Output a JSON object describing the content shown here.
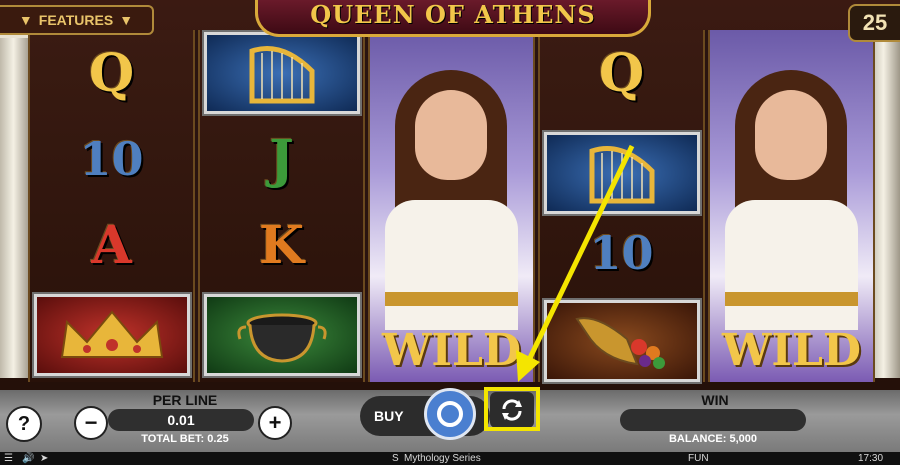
{
  "header": {
    "title": "QUEEN OF ATHENS",
    "features_label": "FEATURES",
    "lines_count": "25"
  },
  "reels": [
    {
      "symbols": [
        "Q",
        "10",
        "A",
        "crown"
      ]
    },
    {
      "symbols": [
        "harp",
        "J",
        "K",
        "cauldron"
      ]
    },
    {
      "symbols": [
        "wild"
      ]
    },
    {
      "symbols": [
        "Q",
        "harp",
        "10",
        "cornucopia"
      ]
    },
    {
      "symbols": [
        "wild"
      ]
    }
  ],
  "wild_label": "WILD",
  "controls": {
    "help_label": "?",
    "minus_label": "−",
    "plus_label": "+",
    "per_line_label": "PER LINE",
    "per_line_value": "0.01",
    "total_bet_label": "TOTAL BET: 0.25",
    "buy_label": "BUY",
    "win_label": "WIN",
    "win_value": "",
    "balance_label": "BALANCE: 5,000"
  },
  "status": {
    "series": "Mythology Series",
    "mode": "FUN",
    "time": "17:30"
  },
  "colors": {
    "gold": "#f2c64a",
    "highlight": "#f4e500"
  }
}
